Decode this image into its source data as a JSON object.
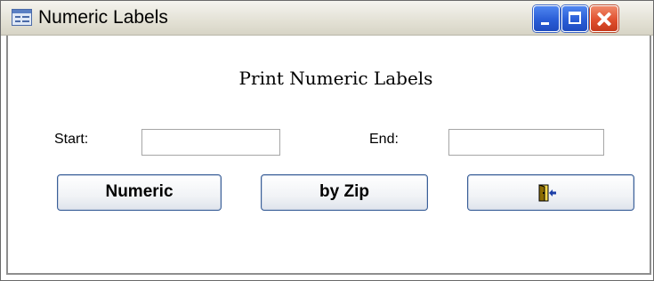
{
  "window": {
    "title": "Numeric Labels",
    "icon": "form-icon",
    "controls": [
      "minimize-icon",
      "maximize-icon",
      "close-icon"
    ]
  },
  "form": {
    "heading": "Print Numeric Labels",
    "start": {
      "label": "Start:",
      "value": ""
    },
    "end": {
      "label": "End:",
      "value": ""
    },
    "buttons": {
      "numeric_label": "Numeric",
      "zip_label": "by Zip",
      "exit_icon": "exit-door-icon"
    }
  },
  "colors": {
    "titlebar_button_blue": "#2a5dd6",
    "close_button_red": "#e0502f",
    "button_border": "#3a5f98",
    "exit_icon_door": "#8a6a00",
    "exit_icon_arrow": "#1c3fa8"
  }
}
